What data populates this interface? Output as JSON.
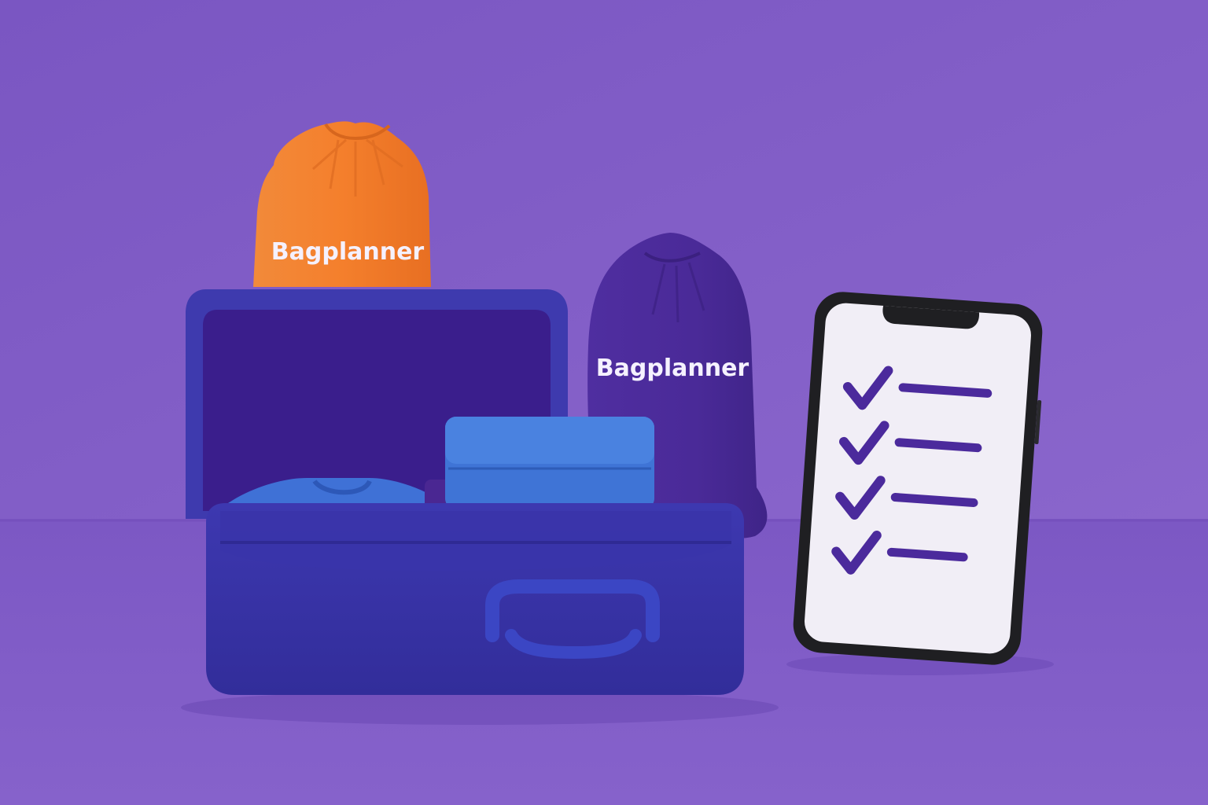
{
  "colors": {
    "background": "#8360c8",
    "suitcase": "#3a35a8",
    "orange_bag": "#f07e2e",
    "purple_bag": "#4a2a9a",
    "phone_screen": "#f1eef6",
    "check_mark": "#4b2a9c"
  },
  "orange_bag": {
    "label": "Bagplanner"
  },
  "purple_bag": {
    "label": "Bagplanner"
  },
  "phone": {
    "checklist": [
      {
        "icon": "check-icon",
        "checked": true
      },
      {
        "icon": "check-icon",
        "checked": true
      },
      {
        "icon": "check-icon",
        "checked": true
      },
      {
        "icon": "check-icon",
        "checked": true
      }
    ]
  }
}
